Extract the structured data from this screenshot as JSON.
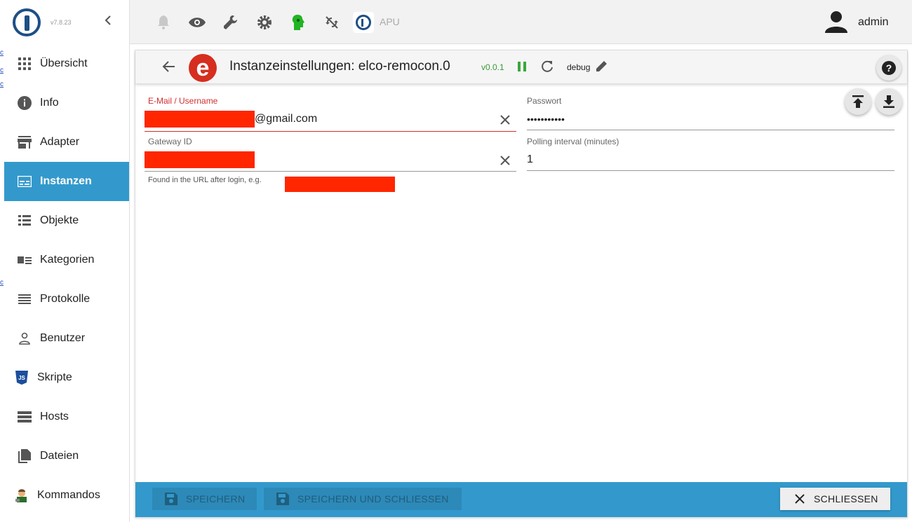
{
  "page_edge": {
    "fragments": [
      "c",
      "c",
      "c",
      "c",
      "c",
      "c"
    ]
  },
  "sidebar": {
    "version": "v7.8.23",
    "items": [
      {
        "label": "Übersicht",
        "icon": "apps-icon"
      },
      {
        "label": "Info",
        "icon": "info-icon"
      },
      {
        "label": "Adapter",
        "icon": "store-icon"
      },
      {
        "label": "Instanzen",
        "icon": "instances-icon",
        "active": true
      },
      {
        "label": "Objekte",
        "icon": "list-icon"
      },
      {
        "label": "Kategorien",
        "icon": "categories-icon"
      },
      {
        "label": "Protokolle",
        "icon": "logs-icon"
      },
      {
        "label": "Benutzer",
        "icon": "user-icon"
      },
      {
        "label": "Skripte",
        "icon": "javascript-icon"
      },
      {
        "label": "Hosts",
        "icon": "hosts-icon"
      },
      {
        "label": "Dateien",
        "icon": "files-icon"
      },
      {
        "label": "Kommandos",
        "icon": "commands-icon"
      }
    ]
  },
  "topbar": {
    "icons": [
      "bell-icon",
      "eye-icon",
      "wrench-icon",
      "gear-icon",
      "expert-mode-icon",
      "sync-off-icon"
    ],
    "host_label": "APU",
    "user_name": "admin"
  },
  "dialog": {
    "title": "Instanzeinstellungen: elco-remocon.0",
    "version": "v0.0.1",
    "log_level": "debug",
    "logo_letter": "e",
    "colors": {
      "accent": "#3399cc",
      "error": "#d32f2f",
      "version": "#3a9a3a",
      "logo": "#d62e1f"
    }
  },
  "form": {
    "email": {
      "label": "E-Mail / Username",
      "value_suffix": "@gmail.com"
    },
    "password": {
      "label": "Passwort",
      "value": "•••••••••••"
    },
    "gateway": {
      "label": "Gateway ID",
      "helper": "Found in the URL after login, e.g."
    },
    "polling": {
      "label": "Polling interval (minutes)",
      "value": "1"
    }
  },
  "footer": {
    "save_label": "SPEICHERN",
    "save_close_label": "SPEICHERN UND SCHLIESSEN",
    "close_label": "SCHLIESSEN"
  }
}
